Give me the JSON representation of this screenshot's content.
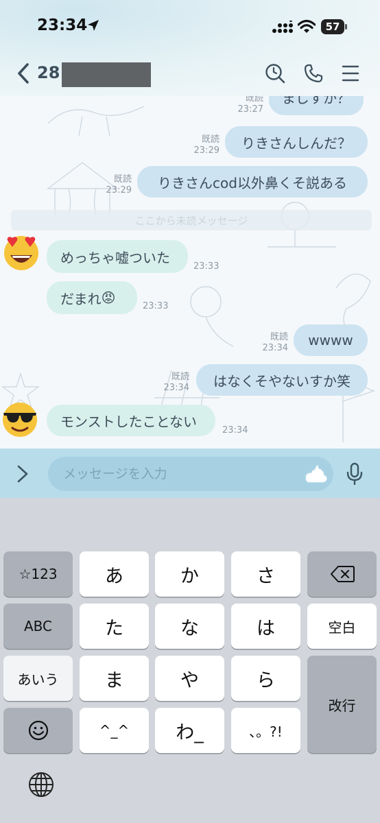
{
  "status": {
    "time": "23:34",
    "battery": "57"
  },
  "header": {
    "title": "28",
    "back_icon": "back-chevron-icon",
    "search_icon": "search-clock-icon",
    "call_icon": "phone-icon",
    "menu_icon": "menu-icon"
  },
  "messages": [
    {
      "dir": "out",
      "text": "まじすか？",
      "read": "既読",
      "time": "23:27"
    },
    {
      "dir": "out",
      "text": "りきさんしんだ？",
      "read": "既読",
      "time": "23:29"
    },
    {
      "dir": "out",
      "text": "りきさんcod以外鼻くそ説ある",
      "read": "既読",
      "time": "23:29"
    },
    {
      "dir": "in",
      "text": "めっちゃ嘘ついた",
      "time": "23:33",
      "avatar": "heart-eyes-emoji"
    },
    {
      "dir": "in",
      "text": "だまれ",
      "emoji": "😡",
      "time": "23:33"
    },
    {
      "dir": "out",
      "text": "wwww",
      "read": "既読",
      "time": "23:34"
    },
    {
      "dir": "out",
      "text": "はなくそやないすか笑",
      "read": "既読",
      "time": "23:34"
    },
    {
      "dir": "in",
      "text": "モンストしたことない",
      "time": "23:34",
      "avatar": "sunglasses-emoji"
    }
  ],
  "unread_divider": "ここから未読メッセージ",
  "input": {
    "placeholder": "メッセージを入力"
  },
  "keyboard": {
    "rows": [
      [
        "☆123",
        "あ",
        "か",
        "さ",
        "⌫"
      ],
      [
        "ABC",
        "た",
        "な",
        "は",
        "空白"
      ],
      [
        "あいう",
        "ま",
        "や",
        "ら",
        "改行"
      ],
      [
        "☺",
        "^_^",
        "わ_",
        "、。?!"
      ]
    ]
  }
}
